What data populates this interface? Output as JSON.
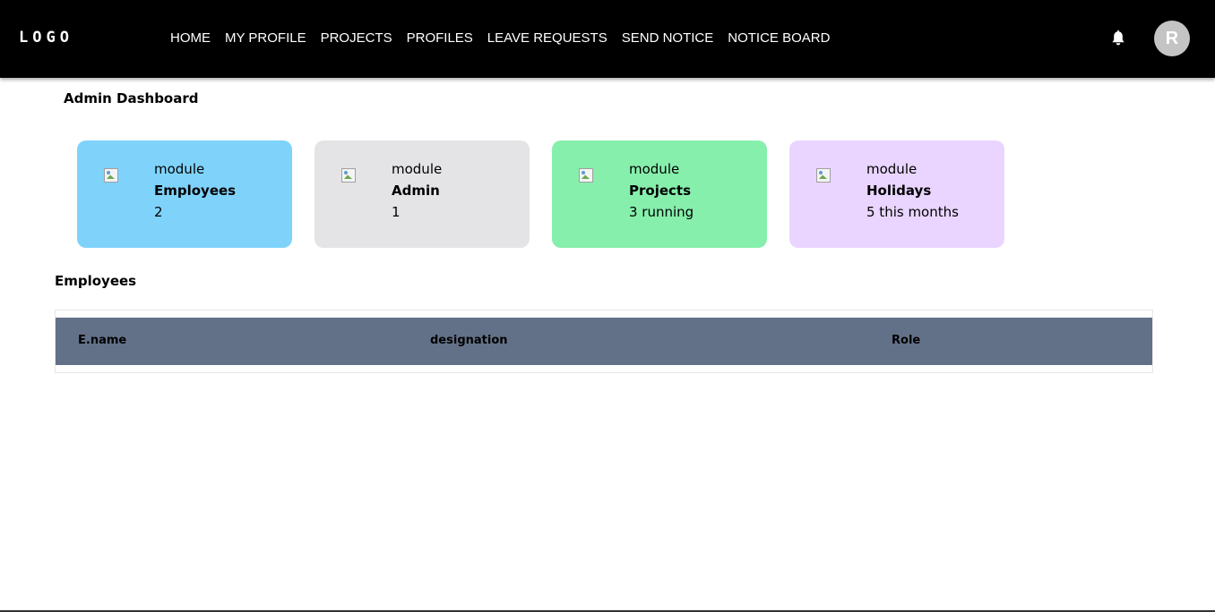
{
  "header": {
    "logo": "LOGO",
    "nav": [
      "HOME",
      "MY PROFILE",
      "PROJECTS",
      "PROFILES",
      "LEAVE REQUESTS",
      "SEND NOTICE",
      "NOTICE BOARD"
    ],
    "notification_icon": "bell-icon",
    "avatar_initial": "R"
  },
  "dashboard": {
    "title": "Admin Dashboard",
    "cards": [
      {
        "caption": "module",
        "name": "Employees",
        "value": "2",
        "color": "#7fd3fb",
        "icon": "broken-image-icon"
      },
      {
        "caption": "module",
        "name": "Admin",
        "value": "1",
        "color": "#e4e4e7",
        "icon": "broken-image-icon"
      },
      {
        "caption": "module",
        "name": "Projects",
        "value": "3 running",
        "color": "#86efac",
        "icon": "broken-image-icon"
      },
      {
        "caption": "module",
        "name": "Holidays",
        "value": "5 this months",
        "color": "#e9d5ff",
        "icon": "broken-image-icon"
      }
    ]
  },
  "employees": {
    "title": "Employees",
    "columns": [
      "E.name",
      "designation",
      "Role"
    ],
    "header_color": "#637188",
    "rows": []
  }
}
